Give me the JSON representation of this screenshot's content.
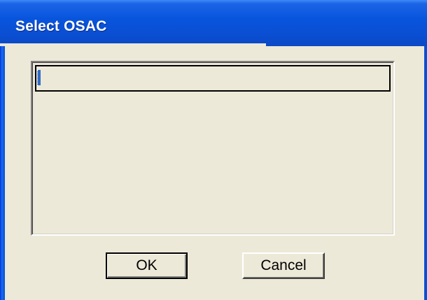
{
  "window": {
    "title": "Select OSAC",
    "title_color": "#ffffff",
    "titlebar_color": "#0a4fd4",
    "background_color": "#ece9d8"
  },
  "list": {
    "items": [
      {
        "label": "",
        "selected": true
      }
    ],
    "selection_color": "#316ac5"
  },
  "buttons": {
    "ok_label": "OK",
    "cancel_label": "Cancel"
  }
}
